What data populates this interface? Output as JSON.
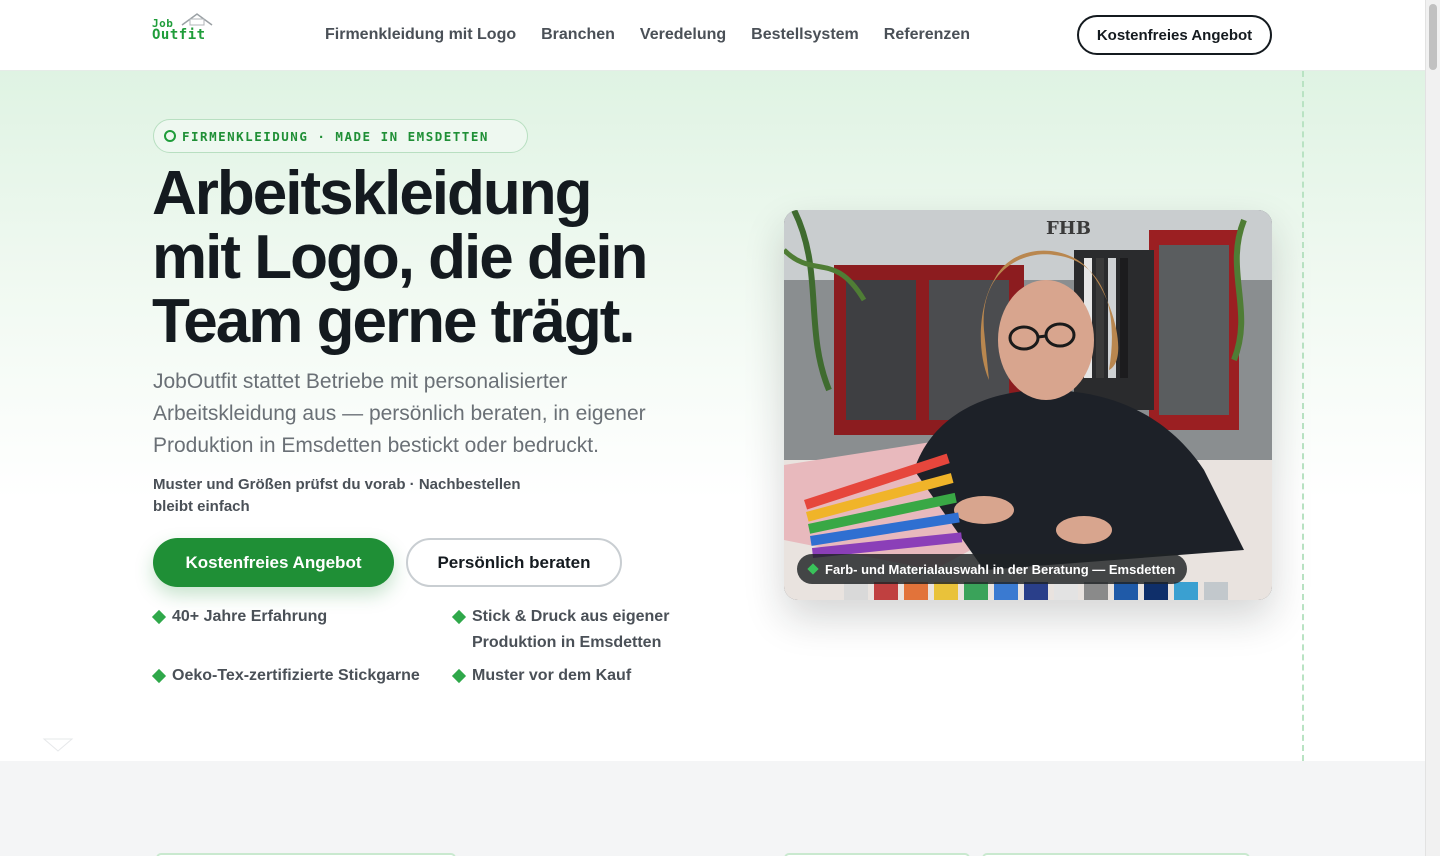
{
  "header": {
    "logo_top": "Job",
    "logo_bottom": "Outfit",
    "nav": [
      "Firmenkleidung mit Logo",
      "Branchen",
      "Veredelung",
      "Bestellsystem",
      "Referenzen"
    ],
    "cta_label": "Kostenfreies Angebot"
  },
  "hero": {
    "eyebrow": "FIRMENKLEIDUNG · MADE IN EMSDETTEN",
    "headline": [
      "Arbeitskleidung",
      "mit Logo, die dein",
      "Team gerne trägt."
    ],
    "lead": "JobOutfit stattet Betriebe mit personalisierter Arbeitskleidung aus — persönlich beraten, in eigener Produktion in Emsdetten bestickt oder bedruckt.",
    "sub": "Muster und Größen prüfst du vorab · Nachbestellen bleibt einfach",
    "primary_button": "Kostenfreies Angebot",
    "secondary_button": "Persönlich beraten",
    "features": [
      "40+ Jahre Erfahrung",
      "Stick & Druck aus eigener Produktion in Emsdetten",
      "Oeko-Tex-zertifizierte Stickgarne",
      "Muster vor dem Kauf"
    ],
    "image_caption": "Farb- und Materialauswahl in der Beratung — Emsdetten",
    "photo_sign": "FHB"
  },
  "colors": {
    "brand_green": "#1f8f36",
    "accent_green": "#2fa84a",
    "text_dark": "#141a1f"
  }
}
